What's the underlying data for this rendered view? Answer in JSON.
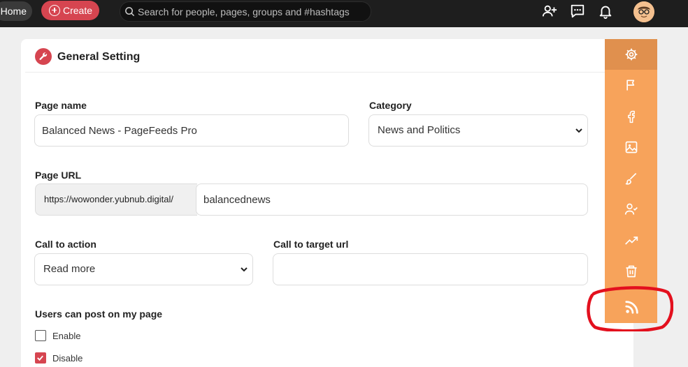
{
  "topbar": {
    "home_label": "Home",
    "create_label": "Create",
    "search_placeholder": "Search for people, pages, groups and #hashtags",
    "icons": [
      "add-user-icon",
      "messages-icon",
      "notifications-bell-icon",
      "avatar"
    ]
  },
  "card": {
    "title": "General Setting",
    "page_name": {
      "label": "Page name",
      "value": "Balanced News - PageFeeds Pro"
    },
    "category": {
      "label": "Category",
      "value": "News and Politics"
    },
    "page_url": {
      "label": "Page URL",
      "prefix": "https://wowonder.yubnub.digital/",
      "value": "balancednews"
    },
    "call_to_action": {
      "label": "Call to action",
      "value": "Read more"
    },
    "call_to_target": {
      "label": "Call to target url",
      "value": ""
    },
    "users_can_post": {
      "label": "Users can post on my page",
      "options": [
        {
          "label": "Enable",
          "checked": false
        },
        {
          "label": "Disable",
          "checked": true
        }
      ]
    }
  },
  "rail": {
    "color": "#f7a35b",
    "active_color": "#e0904e",
    "items": [
      "gear-icon",
      "flag-icon",
      "facebook-icon",
      "image-icon",
      "brush-icon",
      "user-check-icon",
      "trending-icon",
      "trash-icon",
      "rss-feed-icon"
    ],
    "active_index": 0
  },
  "colors": {
    "accent": "#d64550",
    "annotation": "#e3101e"
  }
}
